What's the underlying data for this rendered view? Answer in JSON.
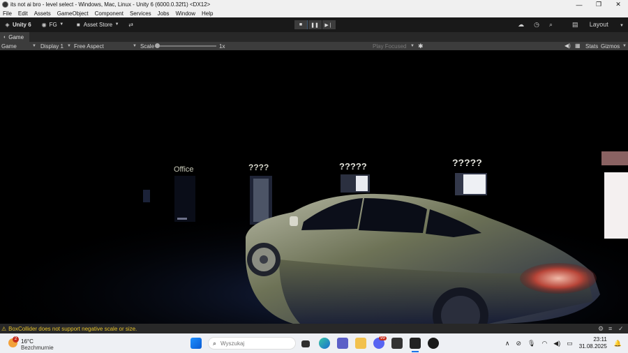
{
  "window": {
    "title": "its not ai bro - level select - Windows, Mac, Linux - Unity 6 (6000.0.32f1) <DX12>",
    "minimize": "—",
    "restore": "❐",
    "close": "✕"
  },
  "menu": [
    "File",
    "Edit",
    "Assets",
    "GameObject",
    "Component",
    "Services",
    "Jobs",
    "Window",
    "Help"
  ],
  "toolbar": {
    "account": "Unity 6",
    "fg": "FG",
    "asset_store": "Asset Store",
    "layout": "Layout"
  },
  "tab": {
    "label": "Game"
  },
  "game_toolbar": {
    "mode": "Game",
    "display": "Display 1",
    "aspect": "Free Aspect",
    "scale_label": "Scale",
    "scale_value": "1x",
    "scale_level": 0,
    "play_focused": "Play Focused",
    "stats": "Stats",
    "gizmos": "Gizmos"
  },
  "scene": {
    "sign_office": "Office",
    "sign_2": "????",
    "sign_3": "?????",
    "sign_4": "?????"
  },
  "status": {
    "warning": "BoxCollider does not support negative scale or size."
  },
  "taskbar": {
    "weather_badge": "2",
    "temperature": "16°C",
    "weather_desc": "Bezchmurnie",
    "search_placeholder": "Wyszukaj",
    "discord_badge": "99",
    "time": "23:11",
    "date": "31.08.2025"
  },
  "colors": {
    "editor_bg": "#191919",
    "warning": "#e6c229",
    "play_active": "#46607c",
    "taskbar": "#eef0f4"
  }
}
